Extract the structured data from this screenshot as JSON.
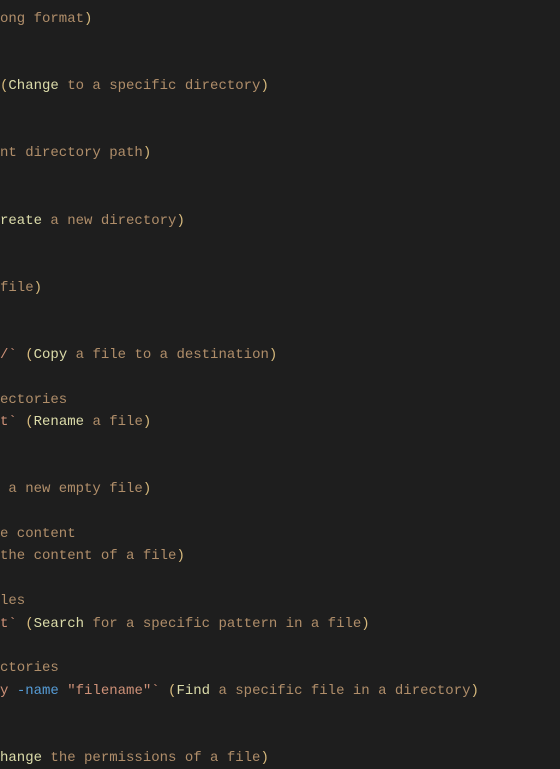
{
  "lines": [
    {
      "parts": [
        {
          "t": "ong format",
          "cls": "c-comment"
        },
        {
          "t": ")",
          "cls": "c-escape"
        }
      ]
    },
    {
      "parts": []
    },
    {
      "parts": []
    },
    {
      "parts": [
        {
          "t": "(",
          "cls": "c-escape"
        },
        {
          "t": "Change",
          "cls": "c-yellow"
        },
        {
          "t": " to a specific directory",
          "cls": "c-comment"
        },
        {
          "t": ")",
          "cls": "c-escape"
        }
      ]
    },
    {
      "parts": []
    },
    {
      "parts": []
    },
    {
      "parts": [
        {
          "t": "nt directory path",
          "cls": "c-comment"
        },
        {
          "t": ")",
          "cls": "c-escape"
        }
      ]
    },
    {
      "parts": []
    },
    {
      "parts": []
    },
    {
      "parts": [
        {
          "t": "reate",
          "cls": "c-yellow"
        },
        {
          "t": " a new directory",
          "cls": "c-comment"
        },
        {
          "t": ")",
          "cls": "c-escape"
        }
      ]
    },
    {
      "parts": []
    },
    {
      "parts": []
    },
    {
      "parts": [
        {
          "t": "file",
          "cls": "c-comment"
        },
        {
          "t": ")",
          "cls": "c-escape"
        }
      ]
    },
    {
      "parts": []
    },
    {
      "parts": []
    },
    {
      "parts": [
        {
          "t": "/` ",
          "cls": "c-string"
        },
        {
          "t": "(",
          "cls": "c-escape"
        },
        {
          "t": "Copy",
          "cls": "c-yellow"
        },
        {
          "t": " a file to a destination",
          "cls": "c-comment"
        },
        {
          "t": ")",
          "cls": "c-escape"
        }
      ]
    },
    {
      "parts": []
    },
    {
      "parts": [
        {
          "t": "ectories",
          "cls": "c-comment"
        }
      ]
    },
    {
      "parts": [
        {
          "t": "t` ",
          "cls": "c-string"
        },
        {
          "t": "(",
          "cls": "c-escape"
        },
        {
          "t": "Rename",
          "cls": "c-yellow"
        },
        {
          "t": " a file",
          "cls": "c-comment"
        },
        {
          "t": ")",
          "cls": "c-escape"
        }
      ]
    },
    {
      "parts": []
    },
    {
      "parts": []
    },
    {
      "parts": [
        {
          "t": " a new empty file",
          "cls": "c-comment"
        },
        {
          "t": ")",
          "cls": "c-escape"
        }
      ]
    },
    {
      "parts": []
    },
    {
      "parts": [
        {
          "t": "e content",
          "cls": "c-comment"
        }
      ]
    },
    {
      "parts": [
        {
          "t": "the content of a file",
          "cls": "c-comment"
        },
        {
          "t": ")",
          "cls": "c-escape"
        }
      ]
    },
    {
      "parts": []
    },
    {
      "parts": [
        {
          "t": "les",
          "cls": "c-comment"
        }
      ]
    },
    {
      "parts": [
        {
          "t": "t` ",
          "cls": "c-string"
        },
        {
          "t": "(",
          "cls": "c-escape"
        },
        {
          "t": "Search",
          "cls": "c-yellow"
        },
        {
          "t": " for a specific pattern in a file",
          "cls": "c-comment"
        },
        {
          "t": ")",
          "cls": "c-escape"
        }
      ]
    },
    {
      "parts": []
    },
    {
      "parts": [
        {
          "t": "ctories",
          "cls": "c-comment"
        }
      ]
    },
    {
      "parts": [
        {
          "t": "y ",
          "cls": "c-string"
        },
        {
          "t": "-name",
          "cls": "c-blue"
        },
        {
          "t": " \"filename\"` ",
          "cls": "c-string"
        },
        {
          "t": "(",
          "cls": "c-escape"
        },
        {
          "t": "Find",
          "cls": "c-yellow"
        },
        {
          "t": " a specific file in a directory",
          "cls": "c-comment"
        },
        {
          "t": ")",
          "cls": "c-escape"
        }
      ]
    },
    {
      "parts": []
    },
    {
      "parts": []
    },
    {
      "parts": [
        {
          "t": "hange",
          "cls": "c-yellow"
        },
        {
          "t": " the permissions of a file",
          "cls": "c-comment"
        },
        {
          "t": ")",
          "cls": "c-escape"
        }
      ]
    }
  ]
}
